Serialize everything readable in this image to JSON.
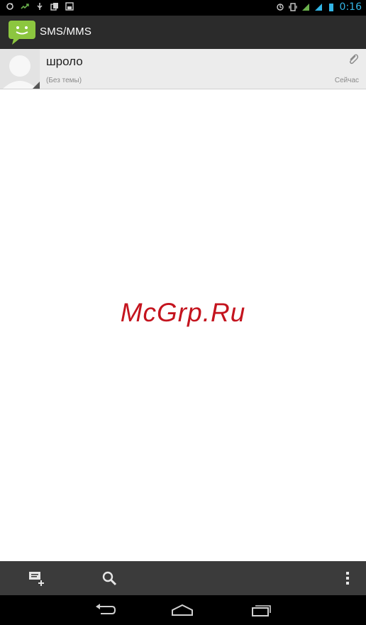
{
  "status_bar": {
    "time": "0:16"
  },
  "action_bar": {
    "title": "SMS/MMS",
    "icon": "messaging-app-icon"
  },
  "conversations": [
    {
      "contact": "шроло",
      "subject": "(Без темы)",
      "time": "Сейчас",
      "has_attachment": true
    }
  ],
  "watermark": "McGrp.Ru",
  "bottom_bar": {
    "icons": [
      "new-message-icon",
      "search-icon",
      "overflow-menu-icon"
    ]
  },
  "nav_bar": {
    "icons": [
      "back-icon",
      "home-icon",
      "recent-apps-icon"
    ]
  },
  "colors": {
    "status_bar": "#000000",
    "action_bar": "#2b2b2b",
    "accent_time": "#33b5e5",
    "app_icon_green": "#8cc63f",
    "watermark": "#c4141e"
  }
}
